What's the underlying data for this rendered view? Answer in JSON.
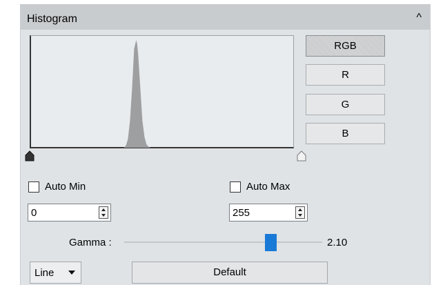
{
  "panel": {
    "title": "Histogram",
    "collapse_glyph": "^"
  },
  "channels": [
    "RGB",
    "R",
    "G",
    "B"
  ],
  "active_channel": "RGB",
  "chart_data": {
    "type": "area",
    "x_range": [
      0,
      255
    ],
    "x": [
      0,
      80,
      90,
      92,
      94,
      96,
      98,
      100,
      102,
      103,
      104,
      106,
      108,
      110,
      112,
      114,
      116,
      125,
      255
    ],
    "y": [
      0,
      0,
      0,
      2,
      8,
      25,
      55,
      92,
      100,
      96,
      85,
      55,
      25,
      10,
      3,
      1,
      0,
      0,
      0
    ],
    "color": "#9e9fa1"
  },
  "auto_min": {
    "label": "Auto Min",
    "checked": false,
    "value": "0"
  },
  "auto_max": {
    "label": "Auto Max",
    "checked": false,
    "value": "255"
  },
  "levels": {
    "min": 0,
    "max": 255
  },
  "gamma": {
    "label": "Gamma :",
    "value_text": "2.10",
    "slider_fraction": 0.74
  },
  "mode": {
    "selected": "Line"
  },
  "default_button": {
    "label": "Default"
  },
  "colors": {
    "accent": "#1979d6",
    "panel_bg": "#dfe3e6",
    "header_bg": "#c9cccf"
  }
}
